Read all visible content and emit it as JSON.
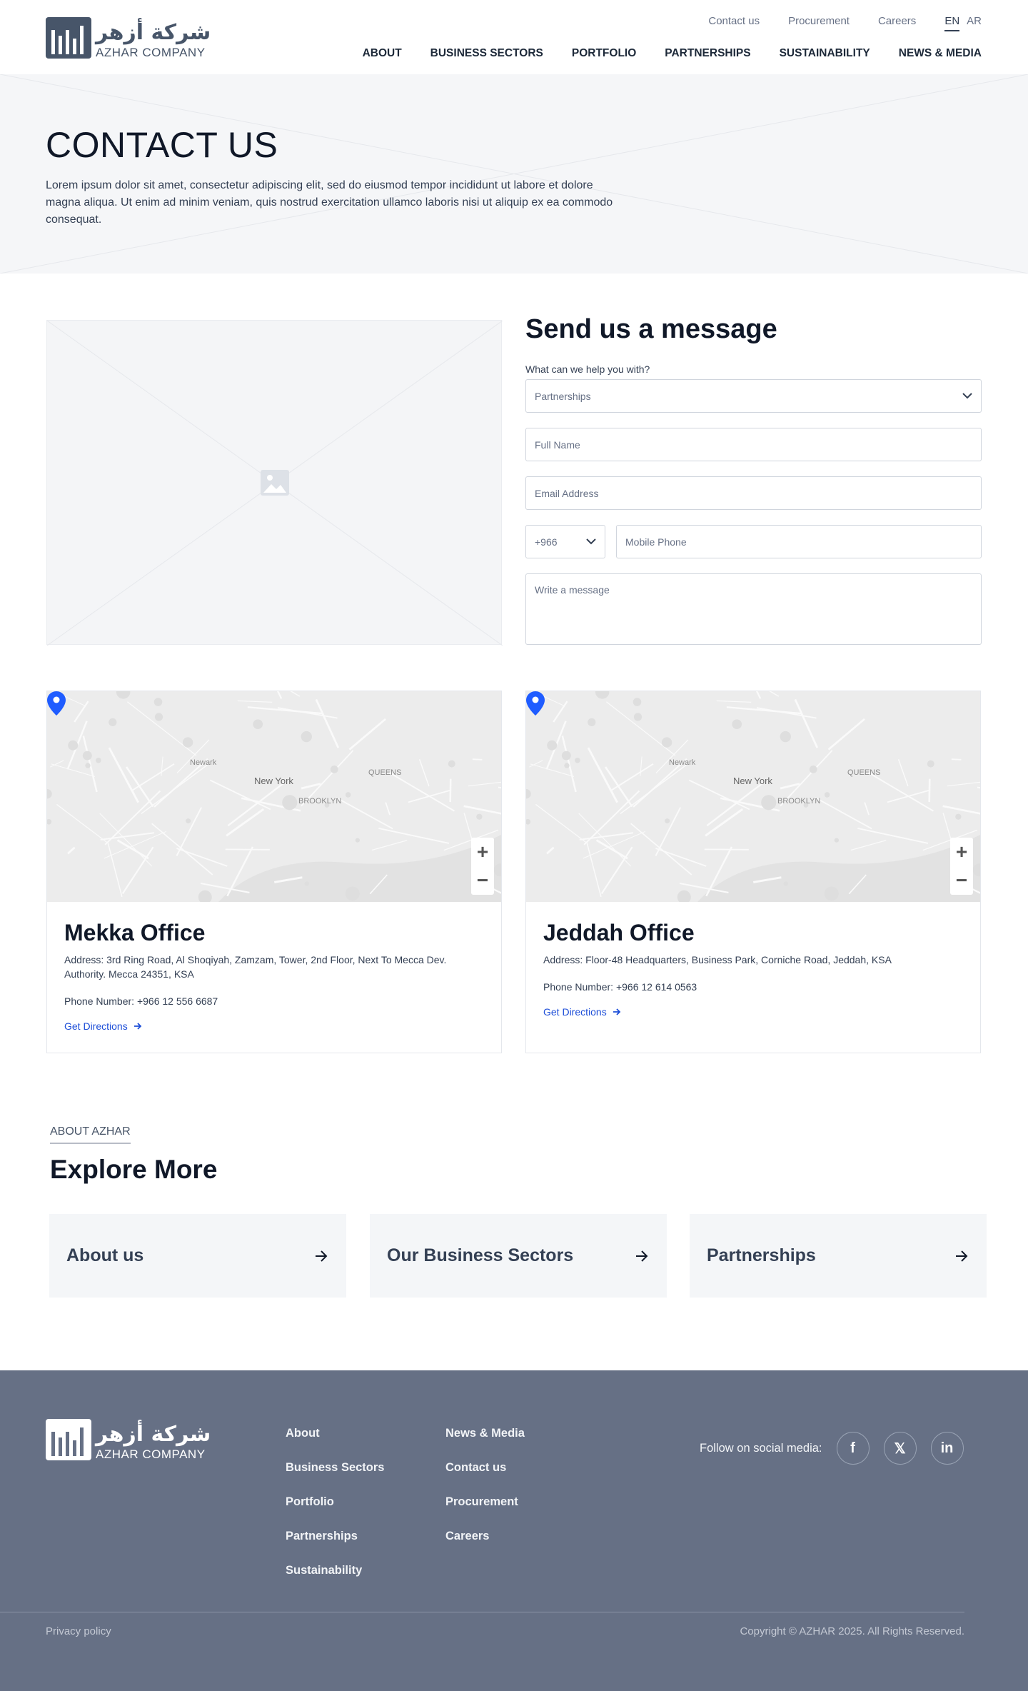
{
  "logo": {
    "arabic": "شركة أزهر",
    "english": "AZHAR COMPANY"
  },
  "header": {
    "top_links": [
      "Contact us",
      "Procurement",
      "Careers"
    ],
    "languages": {
      "en": "EN",
      "ar": "AR"
    },
    "nav": [
      "ABOUT",
      "BUSINESS SECTORS",
      "PORTFOLIO",
      "PARTNERSHIPS",
      "SUSTAINABILITY",
      "NEWS & MEDIA"
    ]
  },
  "hero": {
    "title": "CONTACT US",
    "text": "Lorem ipsum dolor sit amet, consectetur adipiscing elit, sed do eiusmod tempor incididunt ut labore et dolore magna aliqua. Ut enim ad minim veniam, quis nostrud exercitation ullamco laboris nisi ut aliquip ex ea commodo consequat."
  },
  "form": {
    "title": "Send us a message",
    "help_label": "What can we help you with?",
    "help_value": "Partnerships",
    "full_name_placeholder": "Full Name",
    "email_placeholder": "Email Address",
    "country_code": "+966",
    "mobile_placeholder": "Mobile Phone",
    "message_placeholder": "Write a message"
  },
  "map": {
    "labels": {
      "city": "New York",
      "a": "Newark",
      "b": "BROOKLYN",
      "c": "QUEENS"
    },
    "zoom_in": "+",
    "zoom_out": "−",
    "accent": "#1f5cff"
  },
  "offices": [
    {
      "name": "Mekka Office",
      "address": "Address: 3rd Ring Road, Al Shoqiyah, Zamzam, Tower, 2nd Floor, Next To Mecca Dev. Authority. Mecca 24351, KSA",
      "phone": "Phone Number: +966 12 556 6687",
      "directions": "Get Directions"
    },
    {
      "name": "Jeddah Office",
      "address": "Address: Floor-48 Headquarters, Business Park, Corniche Road, Jeddah, KSA",
      "phone": "Phone Number: +966 12 614 0563",
      "directions": "Get Directions"
    }
  ],
  "explore": {
    "eyebrow": "ABOUT AZHAR",
    "title": "Explore More",
    "cards": [
      "About us",
      "Our Business Sectors",
      "Partnerships"
    ]
  },
  "footer": {
    "col1": [
      "About",
      "Business Sectors",
      "Portfolio",
      "Partnerships",
      "Sustainability"
    ],
    "col2": [
      "News & Media",
      "Contact us",
      "Procurement",
      "Careers"
    ],
    "social_label": "Follow on social media:",
    "social": {
      "facebook": "f",
      "x": "𝕏",
      "linkedin": "in"
    },
    "privacy": "Privacy policy",
    "copyright": "Copyright © AZHAR 2025. All Rights Reserved."
  }
}
